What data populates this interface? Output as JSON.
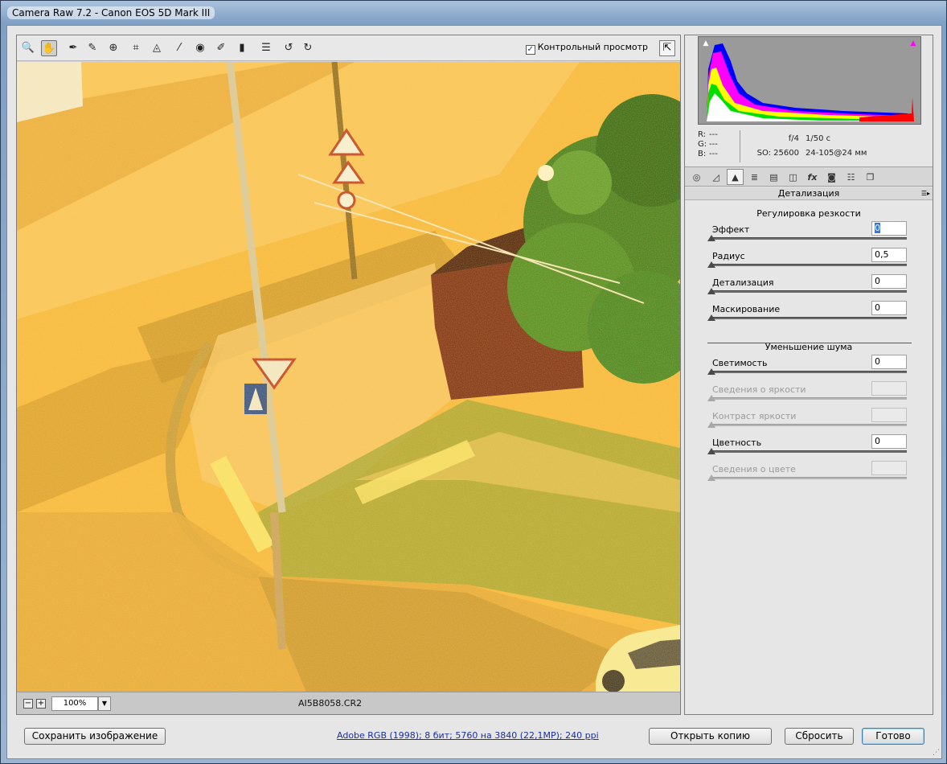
{
  "window": {
    "title": "Camera Raw 7.2  -  Canon EOS 5D Mark III"
  },
  "toolbar": {
    "tools": [
      {
        "name": "zoom-tool",
        "icon": "magnifier-icon",
        "glyph": "🔍"
      },
      {
        "name": "hand-tool",
        "icon": "hand-icon",
        "glyph": "✋"
      },
      {
        "name": "white-balance-tool",
        "icon": "eyedropper-icon",
        "glyph": "✒"
      },
      {
        "name": "color-sampler-tool",
        "icon": "color-sampler-icon",
        "glyph": "✎"
      },
      {
        "name": "targeted-adjustment-tool",
        "icon": "target-icon",
        "glyph": "⊕"
      },
      {
        "name": "crop-tool",
        "icon": "crop-icon",
        "glyph": "⌗"
      },
      {
        "name": "straighten-tool",
        "icon": "straighten-icon",
        "glyph": "◬"
      },
      {
        "name": "spot-removal-tool",
        "icon": "brush-heal-icon",
        "glyph": "⁄"
      },
      {
        "name": "red-eye-tool",
        "icon": "eye-icon",
        "glyph": "◉"
      },
      {
        "name": "adjustment-brush-tool",
        "icon": "brush-icon",
        "glyph": "✐"
      },
      {
        "name": "graduated-filter-tool",
        "icon": "gradient-icon",
        "glyph": "▮"
      },
      {
        "name": "preferences-tool",
        "icon": "list-icon",
        "glyph": "☰"
      },
      {
        "name": "rotate-left-tool",
        "icon": "rotate-ccw-icon",
        "glyph": "↺"
      },
      {
        "name": "rotate-right-tool",
        "icon": "rotate-cw-icon",
        "glyph": "↻"
      }
    ],
    "preview_label": "Контрольный просмотр",
    "preview_checked": "✓"
  },
  "status": {
    "zoom_minus": "−",
    "zoom_plus": "+",
    "zoom_value": "100%",
    "zoom_drop": "▼",
    "filename": "AI5B8058.CR2"
  },
  "readout": {
    "r_label": "R:",
    "r_value": "---",
    "g_label": "G:",
    "g_value": "---",
    "b_label": "B:",
    "b_value": "---",
    "aperture": "f/4",
    "shutter": "1/50 с",
    "iso": "SO: 25600",
    "lens": "24-105@24 мм"
  },
  "panel_tabs": [
    {
      "name": "tab-basic",
      "icon": "aperture-icon",
      "glyph": "◎"
    },
    {
      "name": "tab-tone-curve",
      "icon": "curve-icon",
      "glyph": "◿"
    },
    {
      "name": "tab-detail",
      "icon": "triangles-icon",
      "glyph": "▲"
    },
    {
      "name": "tab-hsl",
      "icon": "hsl-icon",
      "glyph": "≣"
    },
    {
      "name": "tab-split-toning",
      "icon": "split-icon",
      "glyph": "▤"
    },
    {
      "name": "tab-lens-corrections",
      "icon": "lens-icon",
      "glyph": "◫"
    },
    {
      "name": "tab-effects",
      "icon": "fx-icon",
      "glyph": "fx"
    },
    {
      "name": "tab-camera-calibration",
      "icon": "camera-icon",
      "glyph": "◙"
    },
    {
      "name": "tab-presets",
      "icon": "sliders-icon",
      "glyph": "☷"
    },
    {
      "name": "tab-snapshots",
      "icon": "snapshot-icon",
      "glyph": "❐"
    }
  ],
  "panel": {
    "title": "Детализация",
    "menu_glyph": "☰▸",
    "sharpening": {
      "title": "Регулировка резкости",
      "sliders": [
        {
          "label": "Эффект",
          "value": "0",
          "position": 0.0
        },
        {
          "label": "Радиус",
          "value": "0,5",
          "position": 0.0
        },
        {
          "label": "Детализация",
          "value": "0",
          "position": 0.0
        },
        {
          "label": "Маскирование",
          "value": "0",
          "position": 0.0
        }
      ]
    },
    "noise": {
      "title": "Уменьшение шума",
      "sliders": [
        {
          "label": "Светимость",
          "value": "0",
          "position": 0.0
        },
        {
          "label": "Сведения о яркости",
          "value": "",
          "position": 0.0
        },
        {
          "label": "Контраст яркости",
          "value": "",
          "position": 0.0
        },
        {
          "label": "Цветность",
          "value": "0",
          "position": 0.0
        },
        {
          "label": "Сведения о цвете",
          "value": "",
          "position": 0.0
        }
      ]
    }
  },
  "bottom": {
    "save_label": "Сохранить изображение",
    "info_link": "Adobe RGB (1998); 8 бит; 5760 на 3840 (22,1MP); 240 ppi",
    "open_copy_label": "Открыть копию",
    "reset_label": "Сбросить",
    "done_label": "Готово"
  },
  "colors": {
    "photo_orange": "#f5b53c",
    "focus_blue": "#3875d7",
    "link_blue": "#1a2fa0"
  }
}
